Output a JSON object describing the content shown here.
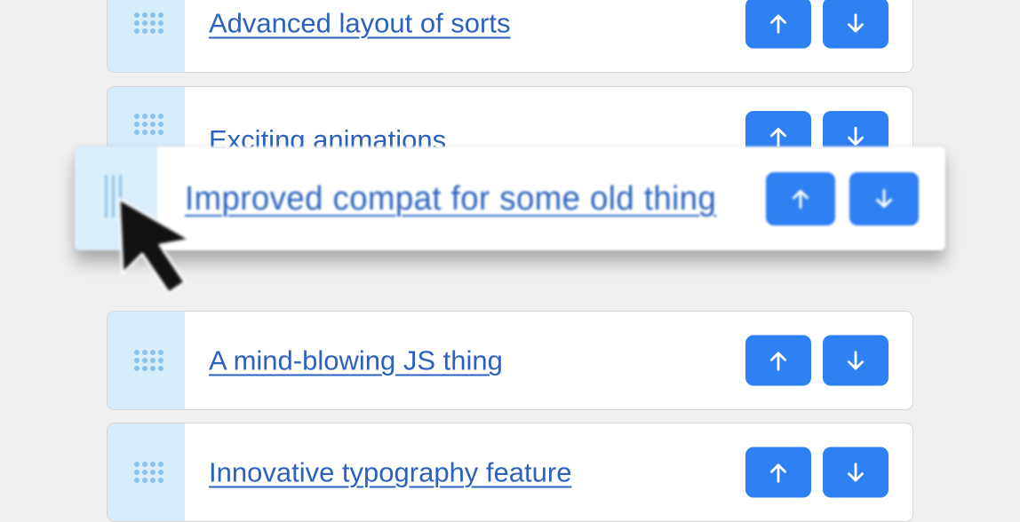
{
  "items": [
    {
      "title": "Advanced layout of sorts"
    },
    {
      "title": "Exciting animations"
    },
    {
      "title": "A mind-blowing JS thing"
    },
    {
      "title": "Innovative typography feature"
    }
  ],
  "dragged_item": {
    "title": "Improved compat for some old thing"
  },
  "icons": {
    "handle": "drag-handle-icon",
    "up": "arrow-up-icon",
    "down": "arrow-down-icon",
    "cursor": "mouse-pointer-icon"
  },
  "colors": {
    "background": "#f0f0f0",
    "card": "#ffffff",
    "handle_bg": "#d8edfb",
    "handle_dots": "#86c2ec",
    "link": "#2a62bd",
    "button": "#2f80f2"
  }
}
